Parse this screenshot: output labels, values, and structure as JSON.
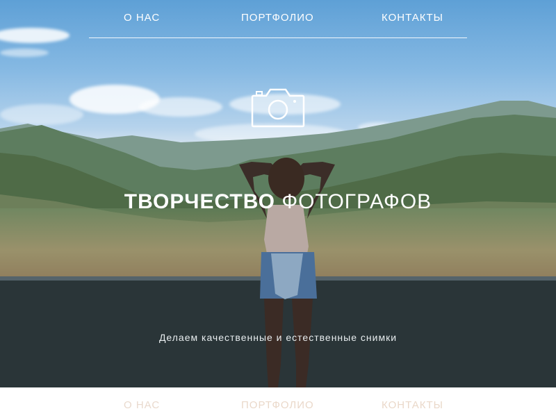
{
  "nav": {
    "about": "О НАС",
    "portfolio": "ПОРТФОЛИО",
    "contacts": "КОНТАКТЫ"
  },
  "hero": {
    "title_bold": "ТВОРЧЕСТВО",
    "title_light": " ФОТОГРАФОВ",
    "subtitle": "Делаем качественные и естественные снимки",
    "icon": "camera-icon"
  },
  "footer_nav": {
    "about": "О НАС",
    "portfolio": "ПОРТФОЛИО",
    "contacts": "КОНТАКТЫ"
  },
  "colors": {
    "nav_text": "#ffffff",
    "footer_text": "#e9d9cd",
    "wall": "#2a3538"
  }
}
